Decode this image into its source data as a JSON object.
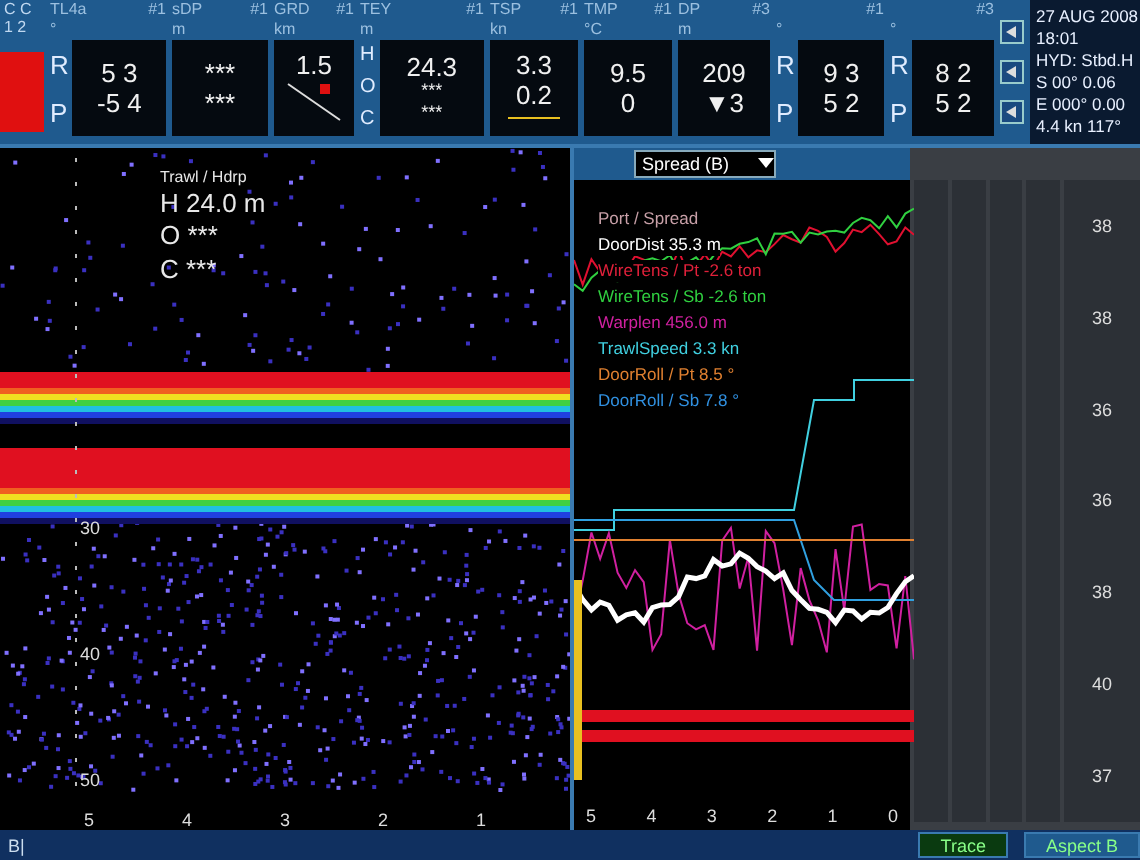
{
  "top_bar": {
    "corner_labels": [
      "C C",
      "1 2"
    ],
    "instruments": [
      {
        "label": "TL4a",
        "channel": "#1",
        "unit": "°",
        "kind": "rp",
        "row_labels": [
          "R",
          "P"
        ],
        "values": [
          "5 3",
          "-5 4"
        ]
      },
      {
        "label": "sDP",
        "channel": "#1",
        "unit": "m",
        "kind": "plain",
        "values": [
          "***",
          "***"
        ]
      },
      {
        "label": "GRD",
        "channel": "#1",
        "unit": "km",
        "kind": "graph",
        "values": [
          "1.5"
        ]
      },
      {
        "label": "TEY",
        "channel": "#1",
        "unit": "m",
        "kind": "hoc",
        "row_labels": [
          "H",
          "O",
          "C"
        ],
        "values": [
          "24.3",
          "***",
          "***"
        ]
      },
      {
        "label": "TSP",
        "channel": "#1",
        "unit": "kn",
        "kind": "speed",
        "values": [
          "3.3",
          "0.2"
        ]
      },
      {
        "label": "TMP",
        "channel": "#1",
        "unit": "°C",
        "kind": "plain",
        "values": [
          "9.5",
          "0"
        ]
      },
      {
        "label": "DP",
        "channel": "#3",
        "unit": "m",
        "kind": "plain",
        "values": [
          "209",
          "▼3"
        ]
      },
      {
        "channel": "#1",
        "unit": "°",
        "kind": "rp",
        "row_labels": [
          "R",
          "P"
        ],
        "values": [
          "9 3",
          "5 2"
        ]
      },
      {
        "channel": "#3",
        "unit": "°",
        "kind": "rp",
        "row_labels": [
          "R",
          "P"
        ],
        "values": [
          "8 2",
          "5 2"
        ]
      }
    ],
    "info": [
      "27 AUG 2008",
      "18:01",
      "HYD: Stbd.H",
      "S 00° 0.06",
      "E 000° 0.00",
      "4.4 kn 117°"
    ]
  },
  "echogram": {
    "readout_title": "Trawl / Hdrp",
    "readouts": [
      "H 24.0 m",
      "O ***",
      "C ***"
    ],
    "depth_labels": [
      "30",
      "40",
      "50"
    ],
    "x_labels": [
      "5",
      "4",
      "3",
      "2",
      "1"
    ]
  },
  "trend": {
    "selector": "Spread (B)",
    "legend": [
      {
        "text": "Port / Spread",
        "color": "#c8a0a8"
      },
      {
        "text": "DoorDist 35.3 m",
        "color": "#ffffff"
      },
      {
        "text": "WireTens / Pt -2.6 ton",
        "color": "#e0203a"
      },
      {
        "text": "WireTens / Sb -2.6 ton",
        "color": "#30d040"
      },
      {
        "text": "Warplen 456.0 m",
        "color": "#d020a0"
      },
      {
        "text": "TrawlSpeed 3.3 kn",
        "color": "#40d0e0"
      },
      {
        "text": "DoorRoll / Pt 8.5 °",
        "color": "#e08030"
      },
      {
        "text": "DoorRoll / Sb 7.8 °",
        "color": "#3090e0"
      }
    ],
    "x_labels": [
      "5",
      "4",
      "3",
      "2",
      "1",
      "0"
    ]
  },
  "scale": {
    "labels": [
      "38",
      "38",
      "36",
      "36",
      "38",
      "40",
      "37"
    ]
  },
  "bottom_bar": {
    "left": "B|",
    "buttons": [
      {
        "label": "Trace",
        "selected": true
      },
      {
        "label": "Aspect B",
        "selected": false
      }
    ]
  }
}
